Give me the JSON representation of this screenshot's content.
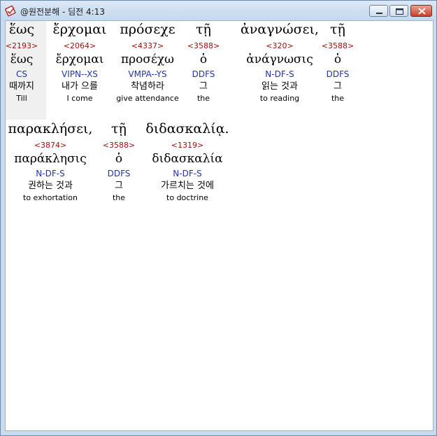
{
  "window": {
    "title": "@원전분해 - 딤전 4:13"
  },
  "rows": [
    [
      {
        "greek": "ἕως",
        "strong": "<2193>",
        "lemma": "ἕως",
        "morph": "CS",
        "korean": "때까지",
        "english": "Till"
      },
      {
        "greek": "ἔρχομαι",
        "strong": "<2064>",
        "lemma": "ἔρχομαι",
        "morph": "VIPN--XS",
        "korean": "내가 으를",
        "english": "I come"
      },
      {
        "greek": "πρόσεχε",
        "strong": "<4337>",
        "lemma": "προσέχω",
        "morph": "VMPA--YS",
        "korean": "착념하라",
        "english": "give attendance"
      },
      {
        "greek": "τῇ",
        "strong": "<3588>",
        "lemma": "ὁ",
        "morph": "DDFS",
        "korean": "그",
        "english": "the"
      },
      {
        "greek": "ἀναγνώσει,",
        "strong": "<320>",
        "lemma": "ἀνάγνωσις",
        "morph": "N-DF-S",
        "korean": "읽는 것과",
        "english": "to reading"
      },
      {
        "greek": "τῇ",
        "strong": "<3588>",
        "lemma": "ὁ",
        "morph": "DDFS",
        "korean": "그",
        "english": "the"
      }
    ],
    [
      {
        "greek": "παρακλήσει,",
        "strong": "<3874>",
        "lemma": "παράκλησις",
        "morph": "N-DF-S",
        "korean": "권하는 것과",
        "english": "to exhortation"
      },
      {
        "greek": "τῇ",
        "strong": "<3588>",
        "lemma": "ὁ",
        "morph": "DDFS",
        "korean": "그",
        "english": "the"
      },
      {
        "greek": "διδασκαλίᾳ.",
        "strong": "<1319>",
        "lemma": "διδασκαλία",
        "morph": "N-DF-S",
        "korean": "가르치는 것에",
        "english": "to doctrine"
      }
    ]
  ]
}
